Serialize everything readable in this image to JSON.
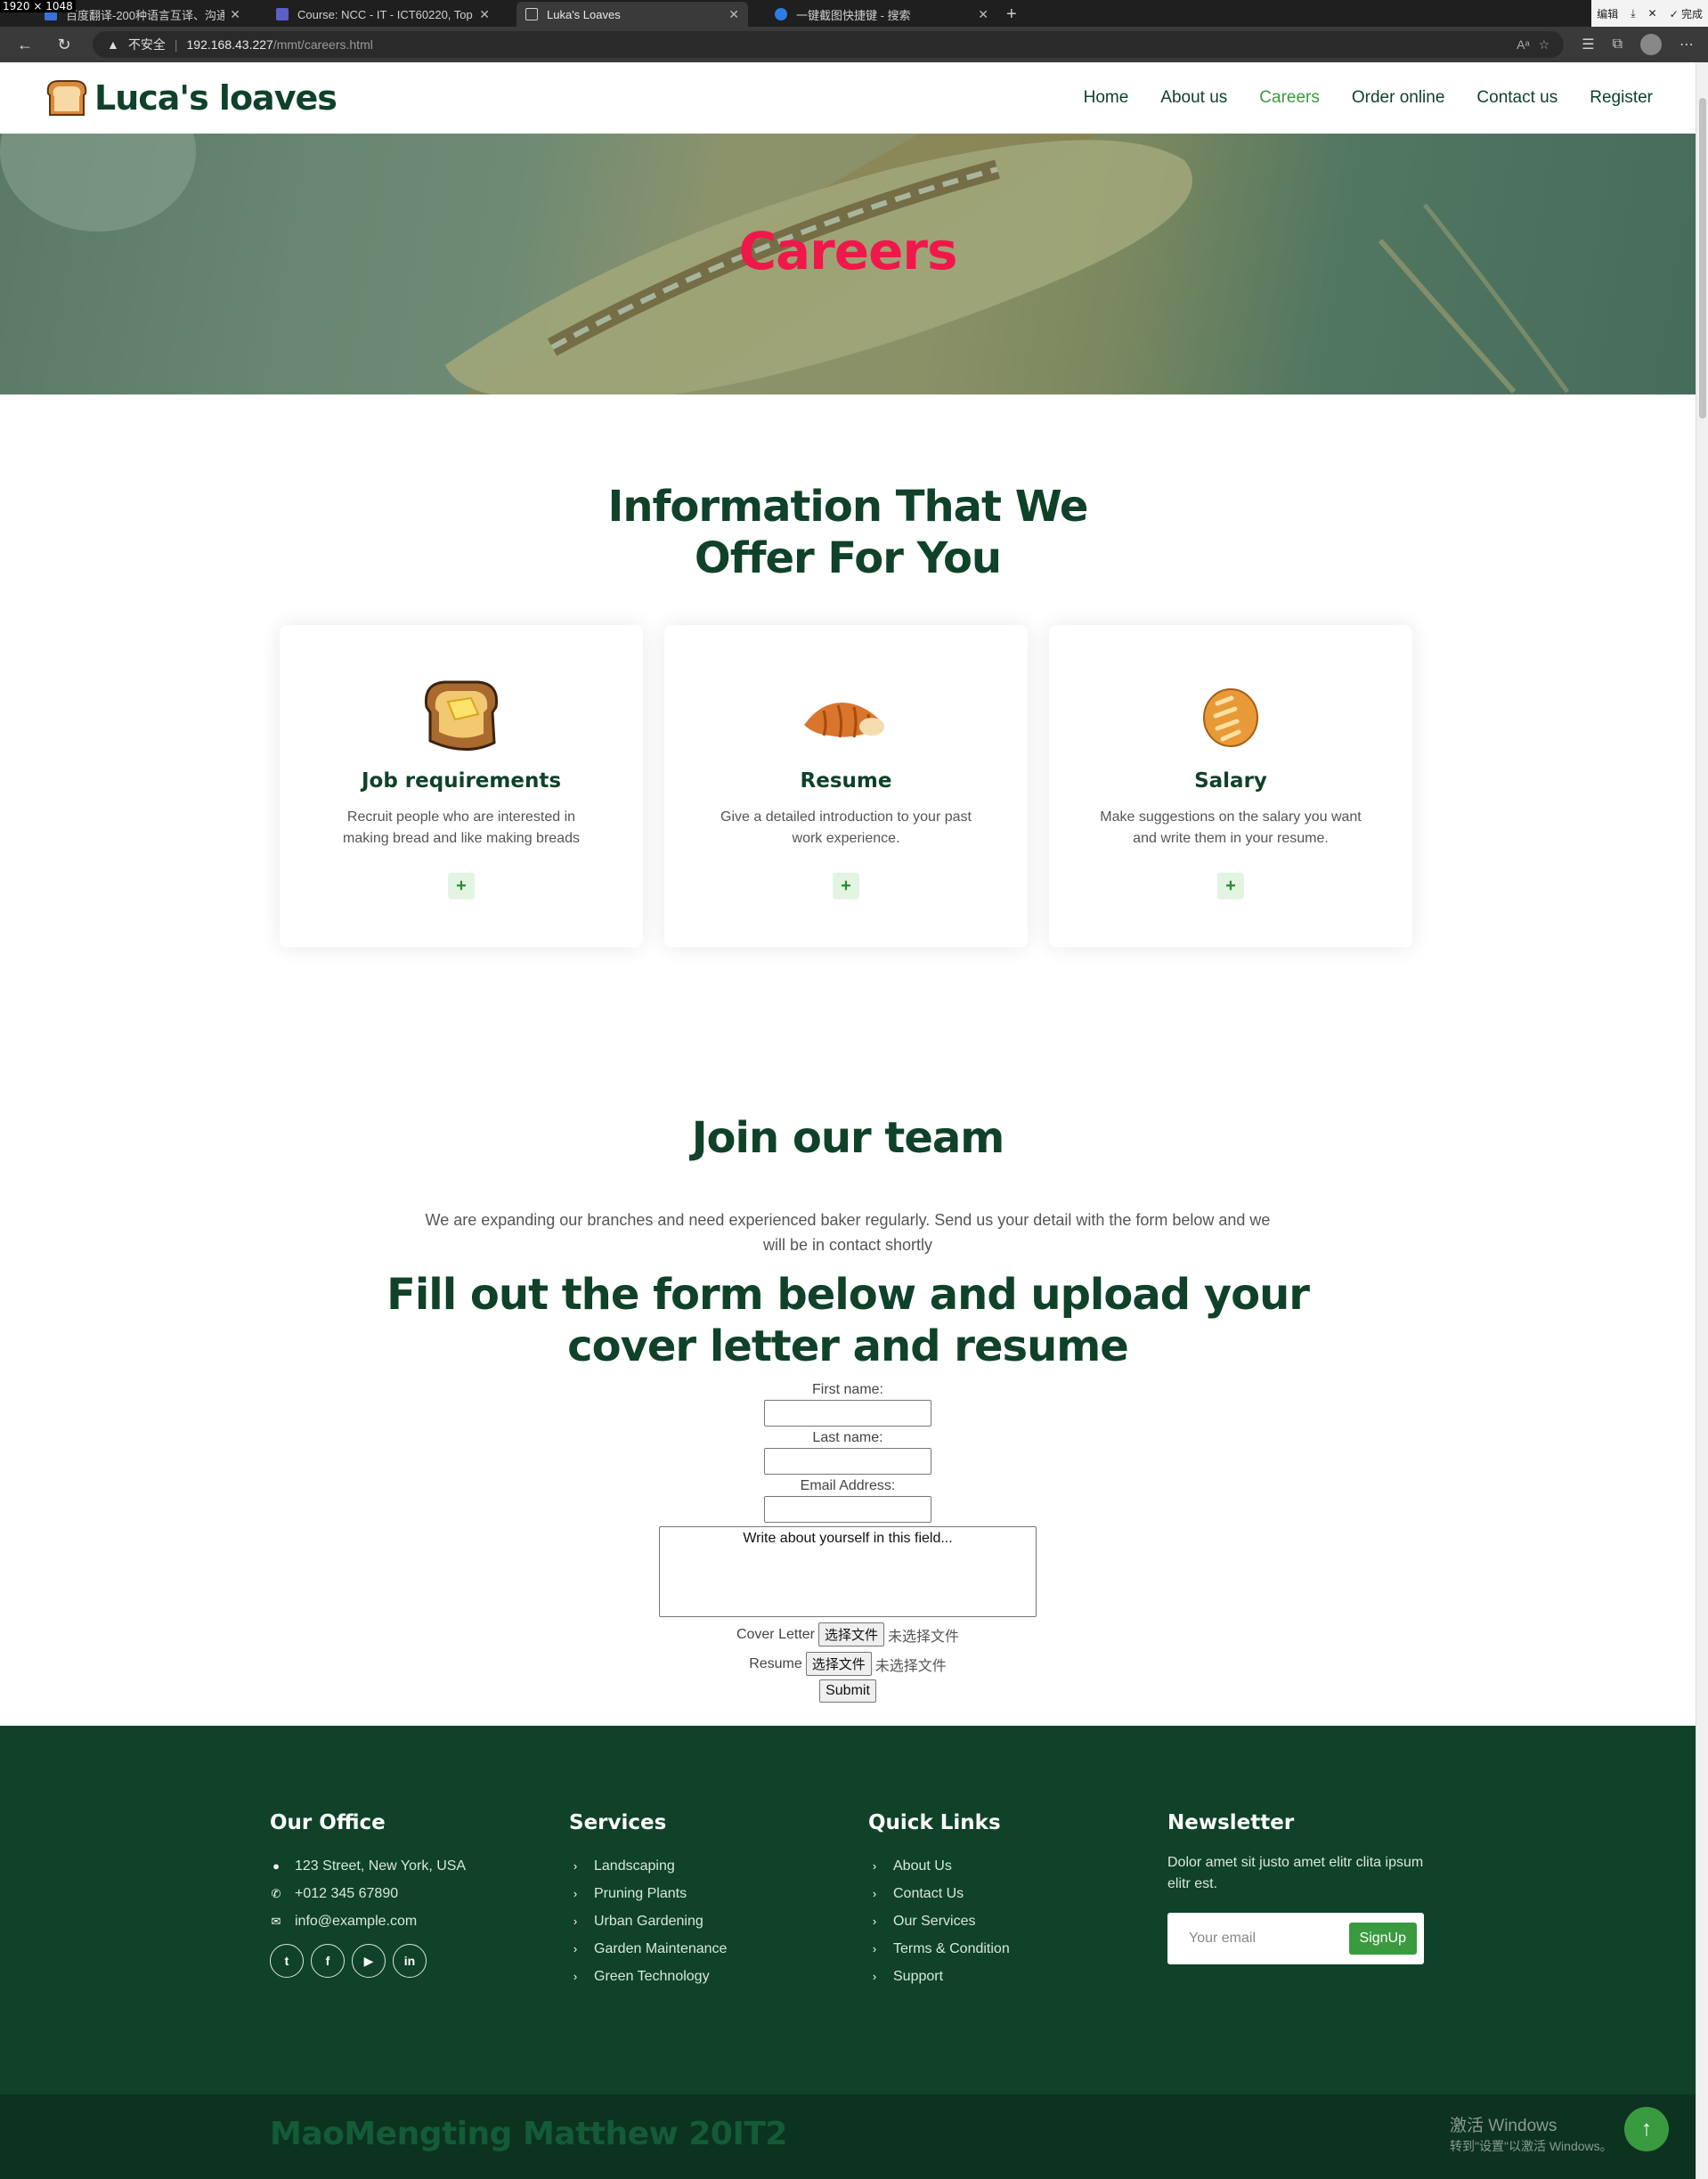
{
  "screen_label": "1920 × 1048",
  "browser": {
    "tabs": [
      {
        "title": "百度翻译-200种语言互译、沟通",
        "active": false,
        "color": "#3b6fd8"
      },
      {
        "title": "Course: NCC - IT - ICT60220, Top",
        "active": false,
        "color": "#5b5fc7"
      },
      {
        "title": "Luka's Loaves",
        "active": true,
        "color": "#cfcfcf"
      },
      {
        "title": "一键截图快捷键 - 搜索",
        "active": false,
        "color": "#2f7be6"
      }
    ],
    "window_controls": {
      "edit": "编辑",
      "done": "完成"
    },
    "address": {
      "security": "不安全",
      "host": "192.168.43.227",
      "path": "/mmt/careers.html"
    }
  },
  "site": {
    "logo_text": "Luca's loaves",
    "nav": [
      "Home",
      "About us",
      "Careers",
      "Order online",
      "Contact us",
      "Register"
    ],
    "active_nav": "Careers",
    "hero_title": "Careers"
  },
  "offer": {
    "heading_line1": "Information That We",
    "heading_line2": "Offer For You",
    "cards": [
      {
        "icon": "toast-icon",
        "title": "Job requirements",
        "text": "Recruit people who are interested in making bread and like making breads"
      },
      {
        "icon": "croissant-icon",
        "title": "Resume",
        "text": "Give a detailed introduction to your past work experience."
      },
      {
        "icon": "baguette-icon",
        "title": "Salary",
        "text": "Make suggestions on the salary you want and write them in your resume."
      }
    ],
    "plus_label": "+"
  },
  "join": {
    "heading": "Join our team",
    "text": "We are expanding our branches and need experienced baker regularly. Send us your detail with the form below and we will be in contact shortly",
    "form_heading_line1": "Fill out the form below and upload your",
    "form_heading_line2": "cover letter and resume"
  },
  "form": {
    "first_name_label": "First name:",
    "last_name_label": "Last name:",
    "email_label": "Email Address:",
    "about_placeholder": "Write about yourself in this field...",
    "cover_letter_label": "Cover Letter",
    "resume_label": "Resume",
    "choose_file": "选择文件",
    "no_file": "未选择文件",
    "submit": "Submit"
  },
  "footer": {
    "office_heading": "Our Office",
    "office": [
      "123 Street, New York, USA",
      "+012 345 67890",
      "info@example.com"
    ],
    "services_heading": "Services",
    "services": [
      "Landscaping",
      "Pruning Plants",
      "Urban Gardening",
      "Garden Maintenance",
      "Green Technology"
    ],
    "links_heading": "Quick Links",
    "links": [
      "About Us",
      "Contact Us",
      "Our Services",
      "Terms & Condition",
      "Support"
    ],
    "newsletter_heading": "Newsletter",
    "newsletter_text": "Dolor amet sit justo amet elitr clita ipsum elitr est.",
    "email_placeholder": "Your email",
    "signup": "SignUp",
    "credit": "MaoMengting Matthew 20IT2"
  },
  "windows_watermark": {
    "line1": "激活 Windows",
    "line2": "转到\"设置\"以激活 Windows。"
  },
  "colors": {
    "brand_green": "#0f4229",
    "accent_green": "#3a9a3f",
    "hero_title": "#f0184a"
  }
}
